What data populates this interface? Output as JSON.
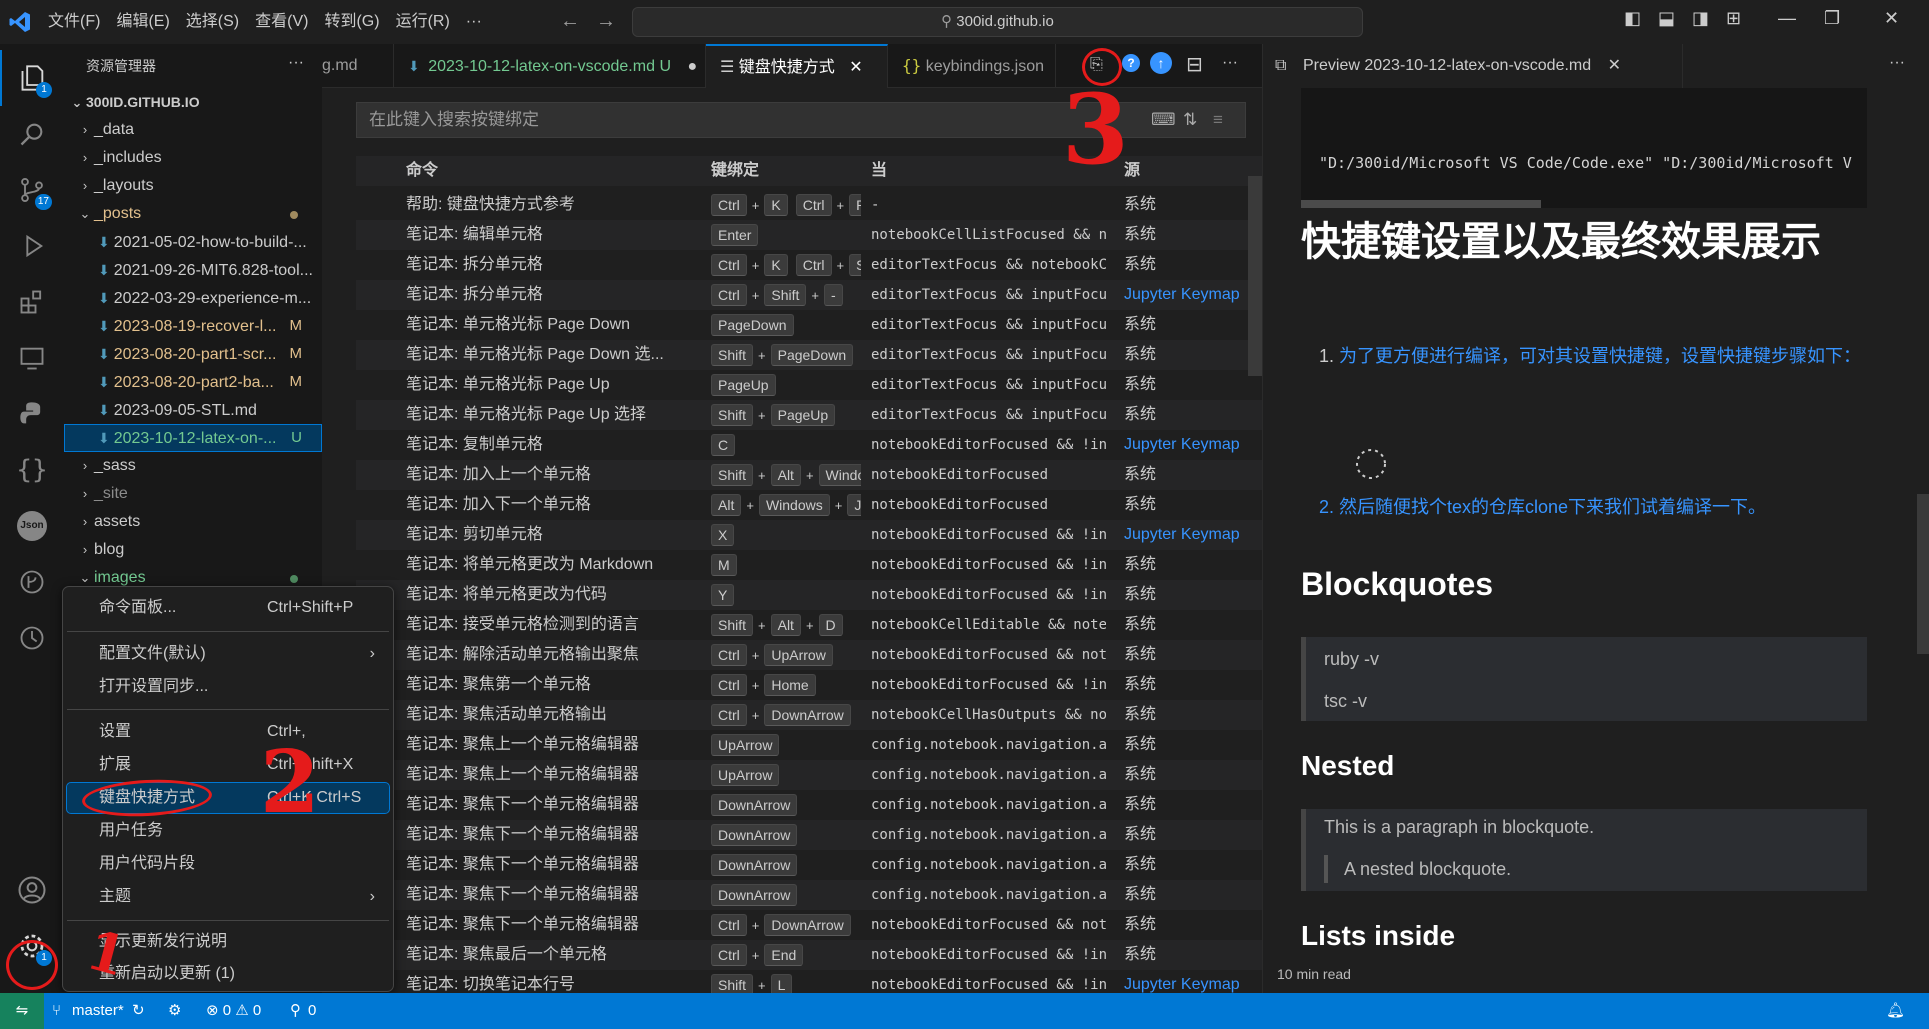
{
  "titlebar": {
    "menus": [
      "文件(F)",
      "编辑(E)",
      "选择(S)",
      "查看(V)",
      "转到(G)",
      "运行(R)",
      "···"
    ],
    "command_center": "300id.github.io"
  },
  "activitybar": {
    "explorer_badge": "1",
    "scm_badge": "17",
    "settings_badge": "1"
  },
  "sidebar": {
    "title": "资源管理器",
    "more": "···",
    "root": "300ID.GITHUB.IO",
    "items": [
      {
        "label": "_data"
      },
      {
        "label": "_includes"
      },
      {
        "label": "_layouts"
      },
      {
        "label": "_posts"
      },
      {
        "label": "2021-05-02-how-to-build-..."
      },
      {
        "label": "2021-09-26-MIT6.828-tool..."
      },
      {
        "label": "2022-03-29-experience-m..."
      },
      {
        "label": "2023-08-19-recover-l...",
        "status": "M"
      },
      {
        "label": "2023-08-20-part1-scr...",
        "status": "M"
      },
      {
        "label": "2023-08-20-part2-ba...",
        "status": "M"
      },
      {
        "label": "2023-09-05-STL.md"
      },
      {
        "label": "2023-10-12-latex-on-...",
        "status": "U"
      },
      {
        "label": "_sass"
      },
      {
        "label": "_site"
      },
      {
        "label": "assets"
      },
      {
        "label": "blog"
      },
      {
        "label": "images"
      }
    ]
  },
  "tabs": [
    {
      "label": "g.md"
    },
    {
      "label": "2023-10-12-latex-on-vscode.md",
      "status": "U"
    },
    {
      "label": "键盘快捷方式"
    },
    {
      "label": "keybindings.json"
    }
  ],
  "keybindings": {
    "search_placeholder": "在此键入搜索按键绑定",
    "headers": {
      "command": "命令",
      "keybinding": "键绑定",
      "when": "当",
      "source": "源"
    },
    "rows": [
      {
        "command": "帮助: 键盘快捷方式参考",
        "keys": [
          [
            "Ctrl",
            "K"
          ],
          [
            "Ctrl",
            "R"
          ]
        ],
        "when": "-",
        "source": "系统"
      },
      {
        "command": "笔记本: 编辑单元格",
        "keys": [
          [
            "Enter"
          ]
        ],
        "when": "notebookCellListFocused && n...",
        "source": "系统"
      },
      {
        "command": "笔记本: 拆分单元格",
        "keys": [
          [
            "Ctrl",
            "K"
          ],
          [
            "Ctrl",
            "Shift"
          ]
        ],
        "when": "editorTextFocus && notebookC...",
        "source": "系统"
      },
      {
        "command": "笔记本: 拆分单元格",
        "keys": [
          [
            "Ctrl",
            "Shift",
            "-"
          ]
        ],
        "when": "editorTextFocus && inputFocu...",
        "source": "Jupyter Keymap"
      },
      {
        "command": "笔记本: 单元格光标 Page Down",
        "keys": [
          [
            "PageDown"
          ]
        ],
        "when": "editorTextFocus && inputFocu...",
        "source": "系统"
      },
      {
        "command": "笔记本: 单元格光标 Page Down 选...",
        "keys": [
          [
            "Shift",
            "PageDown"
          ]
        ],
        "when": "editorTextFocus && inputFocu...",
        "source": "系统"
      },
      {
        "command": "笔记本: 单元格光标 Page Up",
        "keys": [
          [
            "PageUp"
          ]
        ],
        "when": "editorTextFocus && inputFocu...",
        "source": "系统"
      },
      {
        "command": "笔记本: 单元格光标 Page Up 选择",
        "keys": [
          [
            "Shift",
            "PageUp"
          ]
        ],
        "when": "editorTextFocus && inputFocu...",
        "source": "系统"
      },
      {
        "command": "笔记本: 复制单元格",
        "keys": [
          [
            "C"
          ]
        ],
        "when": "notebookEditorFocused && !in...",
        "source": "Jupyter Keymap"
      },
      {
        "command": "笔记本: 加入上一个单元格",
        "keys": [
          [
            "Shift",
            "Alt",
            "Windows"
          ]
        ],
        "when": "notebookEditorFocused",
        "source": "系统"
      },
      {
        "command": "笔记本: 加入下一个单元格",
        "keys": [
          [
            "Alt",
            "Windows",
            "J"
          ]
        ],
        "when": "notebookEditorFocused",
        "source": "系统"
      },
      {
        "command": "笔记本: 剪切单元格",
        "keys": [
          [
            "X"
          ]
        ],
        "when": "notebookEditorFocused && !in...",
        "source": "Jupyter Keymap"
      },
      {
        "command": "笔记本: 将单元格更改为 Markdown",
        "keys": [
          [
            "M"
          ]
        ],
        "when": "notebookEditorFocused && !in...",
        "source": "系统"
      },
      {
        "command": "笔记本: 将单元格更改为代码",
        "keys": [
          [
            "Y"
          ]
        ],
        "when": "notebookEditorFocused && !in...",
        "source": "系统"
      },
      {
        "command": "笔记本: 接受单元格检测到的语言",
        "keys": [
          [
            "Shift",
            "Alt",
            "D"
          ]
        ],
        "when": "notebookCellEditable && note...",
        "source": "系统"
      },
      {
        "command": "笔记本: 解除活动单元格输出聚焦",
        "keys": [
          [
            "Ctrl",
            "UpArrow"
          ]
        ],
        "when": "notebookEditorFocused && not...",
        "source": "系统"
      },
      {
        "command": "笔记本: 聚焦第一个单元格",
        "keys": [
          [
            "Ctrl",
            "Home"
          ]
        ],
        "when": "notebookEditorFocused && !in...",
        "source": "系统"
      },
      {
        "command": "笔记本: 聚焦活动单元格输出",
        "keys": [
          [
            "Ctrl",
            "DownArrow"
          ]
        ],
        "when": "notebookCellHasOutputs && no...",
        "source": "系统"
      },
      {
        "command": "笔记本: 聚焦上一个单元格编辑器",
        "keys": [
          [
            "UpArrow"
          ]
        ],
        "when": "config.notebook.navigation.a...",
        "source": "系统"
      },
      {
        "command": "笔记本: 聚焦上一个单元格编辑器",
        "keys": [
          [
            "UpArrow"
          ]
        ],
        "when": "config.notebook.navigation.a...",
        "source": "系统"
      },
      {
        "command": "笔记本: 聚焦下一个单元格编辑器",
        "keys": [
          [
            "DownArrow"
          ]
        ],
        "when": "config.notebook.navigation.a...",
        "source": "系统"
      },
      {
        "command": "笔记本: 聚焦下一个单元格编辑器",
        "keys": [
          [
            "DownArrow"
          ]
        ],
        "when": "config.notebook.navigation.a...",
        "source": "系统"
      },
      {
        "command": "笔记本: 聚焦下一个单元格编辑器",
        "keys": [
          [
            "DownArrow"
          ]
        ],
        "when": "config.notebook.navigation.a...",
        "source": "系统"
      },
      {
        "command": "笔记本: 聚焦下一个单元格编辑器",
        "keys": [
          [
            "DownArrow"
          ]
        ],
        "when": "config.notebook.navigation.a...",
        "source": "系统"
      },
      {
        "command": "笔记本: 聚焦下一个单元格编辑器",
        "keys": [
          [
            "Ctrl",
            "DownArrow"
          ]
        ],
        "when": "notebookEditorFocused && not...",
        "source": "系统"
      },
      {
        "command": "笔记本: 聚焦最后一个单元格",
        "keys": [
          [
            "Ctrl",
            "End"
          ]
        ],
        "when": "notebookEditorFocused && !in...",
        "source": "系统"
      },
      {
        "command": "笔记本: 切换笔记本行号",
        "keys": [
          [
            "Shift",
            "L"
          ]
        ],
        "when": "notebookEditorFocused && !in...",
        "source": "Jupyter Keymap"
      }
    ]
  },
  "preview": {
    "tab_label": "Preview 2023-10-12-latex-on-vscode.md",
    "code_line": "\"D:/300id/Microsoft VS Code/Code.exe\" \"D:/300id/Microsoft V",
    "h1": "快捷键设置以及最终效果展示",
    "li1": "为了更方便进行编译，可对其设置快捷键，设置快捷键步骤如下：",
    "li2": "2. 然后随便找个tex的仓库clone下来我们试着编译一下。",
    "h2_blockquotes": "Blockquotes",
    "bq1": "ruby -v",
    "bq2": "tsc -v",
    "h3_nested": "Nested",
    "nested_p": "This is a paragraph in blockquote.",
    "nested_inner": "A nested blockquote.",
    "h3_lists": "Lists inside",
    "read_time": "10 min read"
  },
  "context_menu": {
    "items": [
      {
        "label": "命令面板...",
        "shortcut": "Ctrl+Shift+P"
      },
      {
        "label": "配置文件(默认)",
        "submenu": "›"
      },
      {
        "label": "打开设置同步..."
      },
      {
        "label": "设置",
        "shortcut": "Ctrl+,"
      },
      {
        "label": "扩展",
        "shortcut": "Ctrl+Shift+X"
      },
      {
        "label": "键盘快捷方式",
        "shortcut": "Ctrl+K Ctrl+S"
      },
      {
        "label": "用户任务"
      },
      {
        "label": "用户代码片段"
      },
      {
        "label": "主题",
        "submenu": "›"
      },
      {
        "label": "显示更新发行说明"
      },
      {
        "label": "重新启动以更新 (1)"
      }
    ]
  },
  "statusbar": {
    "branch": "master*",
    "problems": "⊗ 0 ⚠ 0",
    "ports": "0"
  },
  "annotations": {
    "mark1": "1",
    "mark2": "2",
    "mark3": "3"
  },
  "colors": {
    "accent": "#0078d4",
    "red_annotation": "#e51b1b",
    "link": "#3794ff",
    "modified": "#e2c08d",
    "untracked": "#73c991"
  }
}
